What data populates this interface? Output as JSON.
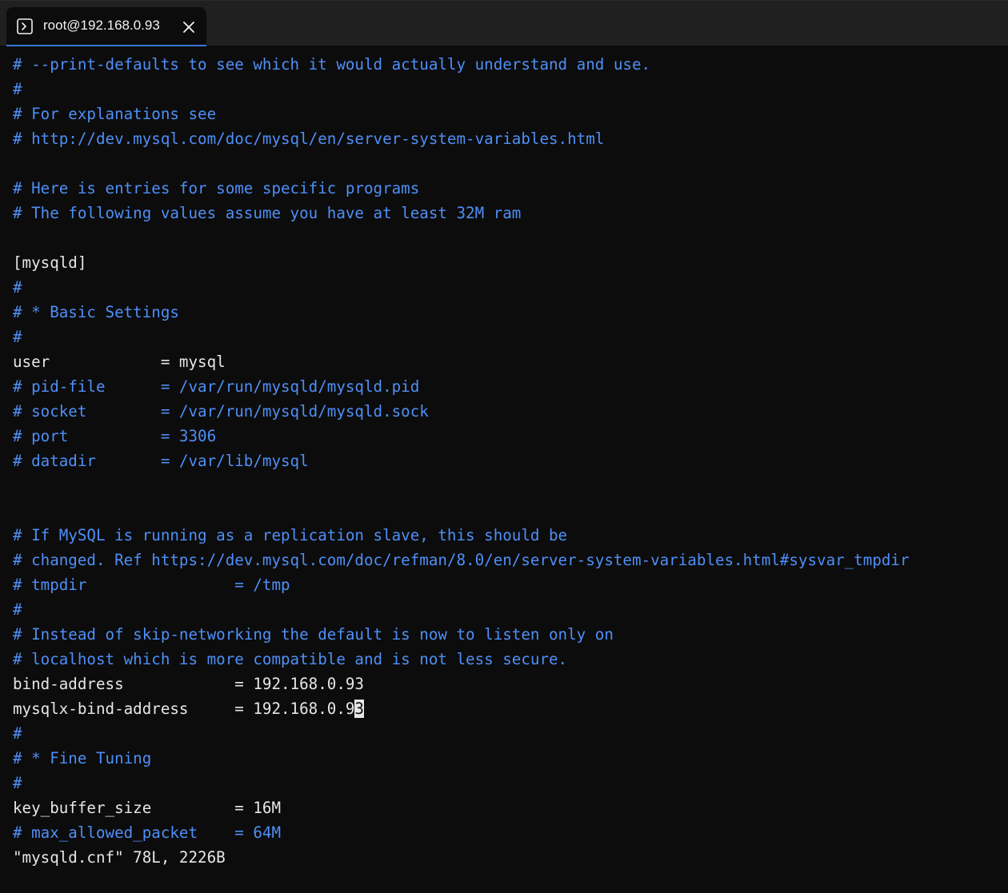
{
  "tab": {
    "title": "root@192.168.0.93",
    "icon": "terminal-icon",
    "close_icon": "close-icon"
  },
  "colors": {
    "background": "#0c0c0c",
    "tabbar": "#202020",
    "comment": "#4f8ff7",
    "text": "#e6e6e6",
    "tab_accent": "#3a78d8"
  },
  "lines": [
    {
      "text": "# --print-defaults to see which it would actually understand and use.",
      "kind": "comment"
    },
    {
      "text": "#",
      "kind": "comment"
    },
    {
      "text": "# For explanations see",
      "kind": "comment"
    },
    {
      "text": "# http://dev.mysql.com/doc/mysql/en/server-system-variables.html",
      "kind": "comment"
    },
    {
      "text": "",
      "kind": "plain"
    },
    {
      "text": "# Here is entries for some specific programs",
      "kind": "comment"
    },
    {
      "text": "# The following values assume you have at least 32M ram",
      "kind": "comment"
    },
    {
      "text": "",
      "kind": "plain"
    },
    {
      "text": "[mysqld]",
      "kind": "plain"
    },
    {
      "text": "#",
      "kind": "comment"
    },
    {
      "text": "# * Basic Settings",
      "kind": "comment"
    },
    {
      "text": "#",
      "kind": "comment"
    },
    {
      "text": "user            = mysql",
      "kind": "plain"
    },
    {
      "text": "# pid-file      = /var/run/mysqld/mysqld.pid",
      "kind": "comment"
    },
    {
      "text": "# socket        = /var/run/mysqld/mysqld.sock",
      "kind": "comment"
    },
    {
      "text": "# port          = 3306",
      "kind": "comment"
    },
    {
      "text": "# datadir       = /var/lib/mysql",
      "kind": "comment"
    },
    {
      "text": "",
      "kind": "plain"
    },
    {
      "text": "",
      "kind": "plain"
    },
    {
      "text": "# If MySQL is running as a replication slave, this should be",
      "kind": "comment"
    },
    {
      "text": "# changed. Ref https://dev.mysql.com/doc/refman/8.0/en/server-system-variables.html#sysvar_tmpdir",
      "kind": "comment"
    },
    {
      "text": "# tmpdir                = /tmp",
      "kind": "comment"
    },
    {
      "text": "#",
      "kind": "comment"
    },
    {
      "text": "# Instead of skip-networking the default is now to listen only on",
      "kind": "comment"
    },
    {
      "text": "# localhost which is more compatible and is not less secure.",
      "kind": "comment"
    },
    {
      "text": "bind-address            = 192.168.0.93",
      "kind": "plain"
    },
    {
      "text": "mysqlx-bind-address     = 192.168.0.93",
      "kind": "plain",
      "cursor_col": 37
    },
    {
      "text": "#",
      "kind": "comment"
    },
    {
      "text": "# * Fine Tuning",
      "kind": "comment"
    },
    {
      "text": "#",
      "kind": "comment"
    },
    {
      "text": "key_buffer_size         = 16M",
      "kind": "plain"
    },
    {
      "text": "# max_allowed_packet    = 64M",
      "kind": "comment"
    },
    {
      "text": "\"mysqld.cnf\" 78L, 2226B",
      "kind": "plain"
    }
  ]
}
